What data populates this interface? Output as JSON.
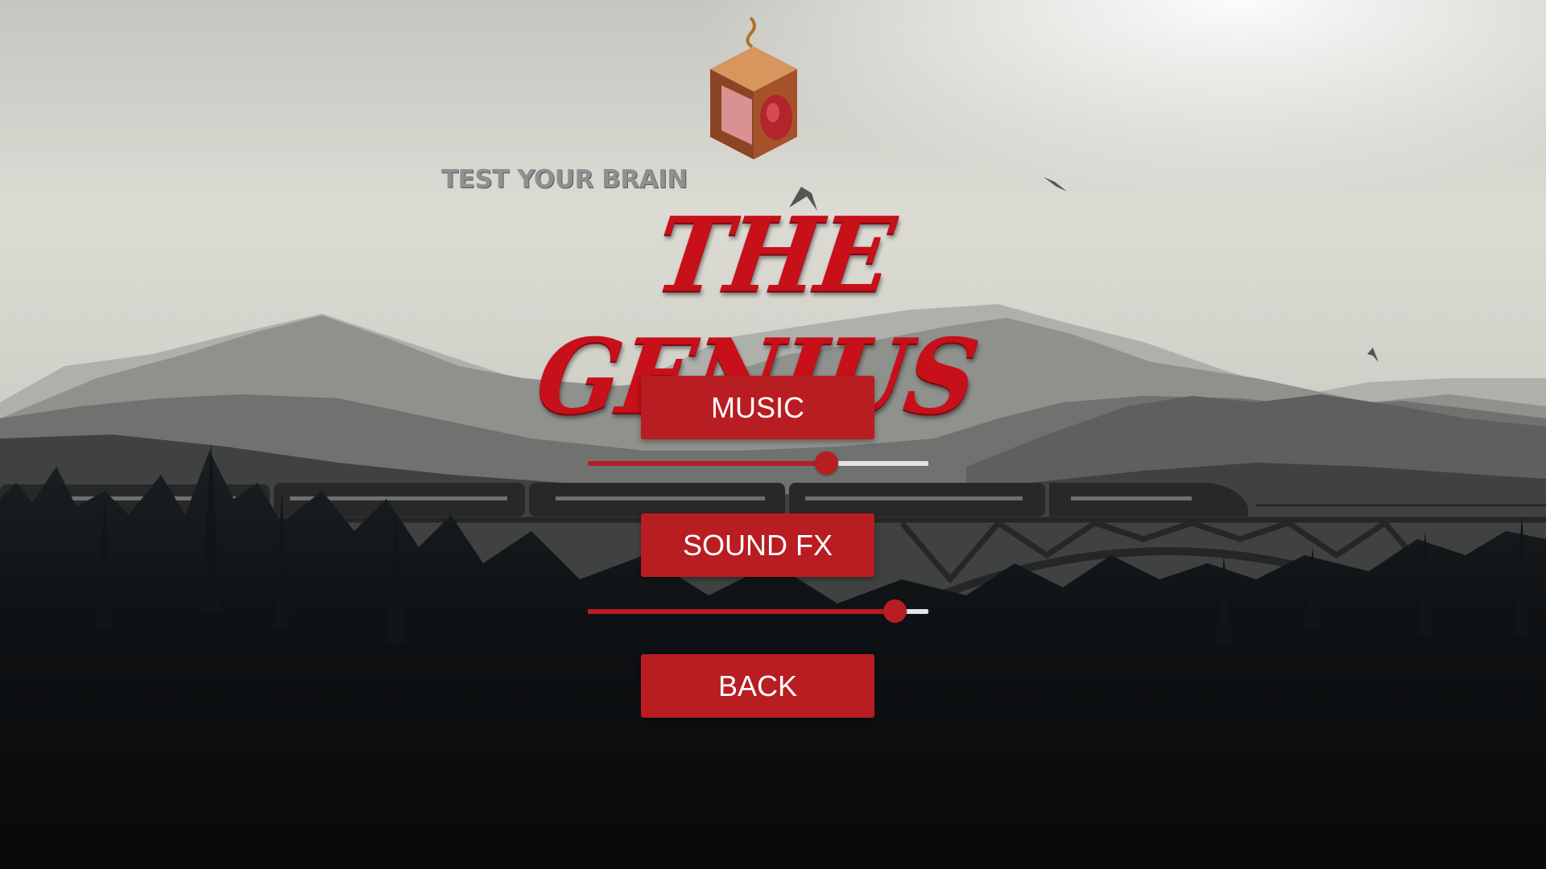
{
  "header": {
    "tagline": "TEST YOUR BRAIN",
    "title": "THE GENIUS"
  },
  "menu": {
    "music_label": "MUSIC",
    "music_volume": 0.7,
    "sound_fx_label": "SOUND FX",
    "sound_fx_volume": 0.9,
    "back_label": "BACK"
  },
  "colors": {
    "accent": "#b81d22",
    "title": "#c8101a",
    "track": "#e4e4e4"
  }
}
